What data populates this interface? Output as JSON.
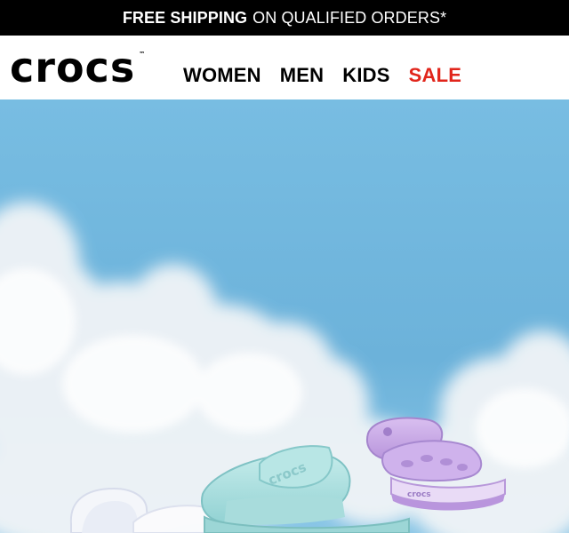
{
  "promo": {
    "bold_text": "FREE SHIPPING",
    "regular_text": "ON QUALIFIED ORDERS*"
  },
  "header": {
    "logo_text": "crocs",
    "logo_tm": "™",
    "nav": [
      {
        "label": "WOMEN"
      },
      {
        "label": "MEN"
      },
      {
        "label": "KIDS"
      },
      {
        "label": "SALE"
      }
    ]
  },
  "hero": {
    "sky_color": "#6fb3da",
    "sale_color": "#e1251b",
    "sandal_text": "crocs",
    "kids_sandal_text": "crocs"
  }
}
